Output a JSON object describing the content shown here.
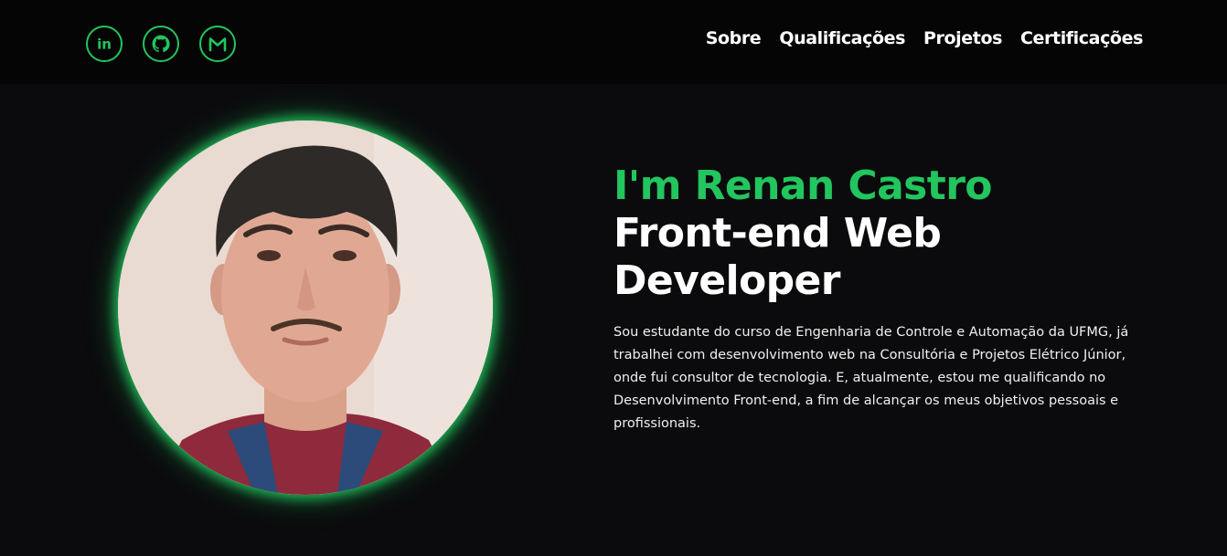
{
  "header": {
    "socials": [
      {
        "icon": "linkedin-icon",
        "label": "in"
      },
      {
        "icon": "github-icon"
      },
      {
        "icon": "gmail-icon",
        "label": "M"
      }
    ],
    "nav": [
      "Sobre",
      "Qualificações",
      "Projetos",
      "Certificações"
    ]
  },
  "hero": {
    "greeting": "I'm Renan Castro",
    "role": "Front-end Web Developer",
    "bio": "Sou estudante do curso de Engenharia de Controle e Automação da UFMG, já trabalhei com desenvolvimento web na Consultória e Projetos Elétrico Júnior, onde fui consultor de tecnologia. E, atualmente, estou me qualificando no Desenvolvimento Front-end, a fim de alcançar os meus objetivos pessoais e profissionais."
  },
  "colors": {
    "accent": "#22c55e",
    "background": "#0b0b0d",
    "header_background": "#050505",
    "text": "#ffffff"
  }
}
